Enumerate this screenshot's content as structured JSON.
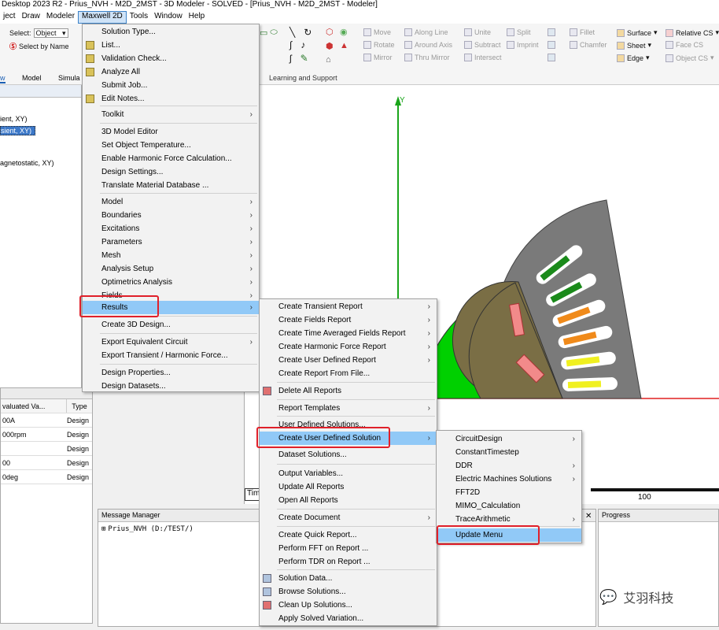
{
  "title_bar": "Desktop 2023 R2 - Prius_NVH - M2D_2MST - 3D Modeler - SOLVED - [Prius_NVH - M2D_2MST - Modeler]",
  "menubar": [
    "ject",
    "Draw",
    "Modeler",
    "Maxwell 2D",
    "Tools",
    "Window",
    "Help"
  ],
  "ribbon": {
    "select_label": "Select:",
    "select_value": "Object",
    "select_by_name": "Select by Name",
    "move": "Move",
    "rotate": "Rotate",
    "mirror": "Mirror",
    "along_line": "Along Line",
    "around_axis": "Around Axis",
    "thru_mirror": "Thru Mirror",
    "unite": "Unite",
    "subtract": "Subtract",
    "intersect": "Intersect",
    "split": "Split",
    "imprint": "Imprint",
    "fillet": "Fillet",
    "chamfer": "Chamfer",
    "surface": "Surface",
    "sheet": "Sheet",
    "edge": "Edge",
    "relative_cs": "Relative CS",
    "face_cs": "Face CS",
    "object_cs": "Object CS",
    "learning": "Learning and Support"
  },
  "tabs": [
    "w",
    "Model",
    "Simula"
  ],
  "tree": {
    "item1": "ient, XY)",
    "item2": "sient, XY)",
    "item3": "agnetostatic, XY)"
  },
  "table": {
    "col1": "valuated Va...",
    "col2": "Type",
    "rows": [
      [
        "00A",
        "Design"
      ],
      [
        "000rpm",
        "Design"
      ],
      [
        "",
        "Design"
      ],
      [
        "00",
        "Design"
      ],
      [
        "0deg",
        "Design"
      ]
    ]
  },
  "canvas": {
    "axis_y": "Y",
    "scale_label": "100",
    "time_label": "Tim"
  },
  "message_manager": {
    "title": "Message Manager",
    "item": "Prius_NVH (D:/TEST/)"
  },
  "progress": {
    "title": "Progress"
  },
  "main_menu": [
    {
      "label": "Solution Type...",
      "icon": ""
    },
    {
      "label": "List...",
      "icon": "list-icon"
    },
    {
      "label": "Validation Check...",
      "icon": "check-icon"
    },
    {
      "label": "Analyze All",
      "icon": "analyze-icon"
    },
    {
      "label": "Submit Job...",
      "icon": ""
    },
    {
      "label": "Edit Notes...",
      "icon": "notes-icon"
    },
    {
      "label": "Toolkit",
      "sub": true
    },
    {
      "label": "3D Model Editor"
    },
    {
      "label": "Set Object Temperature..."
    },
    {
      "label": "Enable Harmonic Force Calculation..."
    },
    {
      "label": "Design Settings..."
    },
    {
      "label": "Translate Material Database ..."
    },
    {
      "label": "Model",
      "sub": true
    },
    {
      "label": "Boundaries",
      "sub": true
    },
    {
      "label": "Excitations",
      "sub": true
    },
    {
      "label": "Parameters",
      "sub": true
    },
    {
      "label": "Mesh",
      "sub": true
    },
    {
      "label": "Analysis Setup",
      "sub": true
    },
    {
      "label": "Optimetrics Analysis",
      "sub": true
    },
    {
      "label": "Fields",
      "sub": true
    },
    {
      "label": "Results",
      "sub": true
    },
    {
      "label": "Create 3D Design..."
    },
    {
      "label": "Export Equivalent Circuit",
      "sub": true
    },
    {
      "label": "Export Transient / Harmonic Force..."
    },
    {
      "label": "Design Properties..."
    },
    {
      "label": "Design Datasets..."
    }
  ],
  "results_menu": [
    {
      "label": "Create Transient Report",
      "sub": true
    },
    {
      "label": "Create Fields Report",
      "sub": true
    },
    {
      "label": "Create Time Averaged Fields Report",
      "sub": true
    },
    {
      "label": "Create Harmonic Force Report",
      "sub": true
    },
    {
      "label": "Create User Defined Report",
      "sub": true
    },
    {
      "label": "Create Report From File..."
    },
    {
      "label": "Delete All Reports"
    },
    {
      "label": "Report Templates",
      "sub": true
    },
    {
      "label": "User Defined Solutions..."
    },
    {
      "label": "Create User Defined Solution",
      "sub": true
    },
    {
      "label": "Dataset Solutions..."
    },
    {
      "label": "Output Variables..."
    },
    {
      "label": "Update All Reports"
    },
    {
      "label": "Open All Reports"
    },
    {
      "label": "Create Document",
      "sub": true
    },
    {
      "label": "Create Quick Report..."
    },
    {
      "label": "Perform FFT on Report ..."
    },
    {
      "label": "Perform TDR on Report ..."
    },
    {
      "label": "Solution Data..."
    },
    {
      "label": "Browse Solutions..."
    },
    {
      "label": "Clean Up Solutions..."
    },
    {
      "label": "Apply Solved Variation..."
    }
  ],
  "uds_menu": [
    {
      "label": "CircuitDesign",
      "sub": true
    },
    {
      "label": "ConstantTimestep"
    },
    {
      "label": "DDR",
      "sub": true
    },
    {
      "label": "Electric Machines Solutions",
      "sub": true
    },
    {
      "label": "FFT2D"
    },
    {
      "label": "MIMO_Calculation"
    },
    {
      "label": "TraceArithmetic",
      "sub": true
    },
    {
      "label": "Update Menu"
    }
  ],
  "watermark": "艾羽科技",
  "colors": {
    "highlight": "#91c9f7",
    "callout": "#e0202a",
    "stator": "#7a7a7a",
    "rotor": "#7a6e45",
    "airgap_green": "#00d000"
  }
}
